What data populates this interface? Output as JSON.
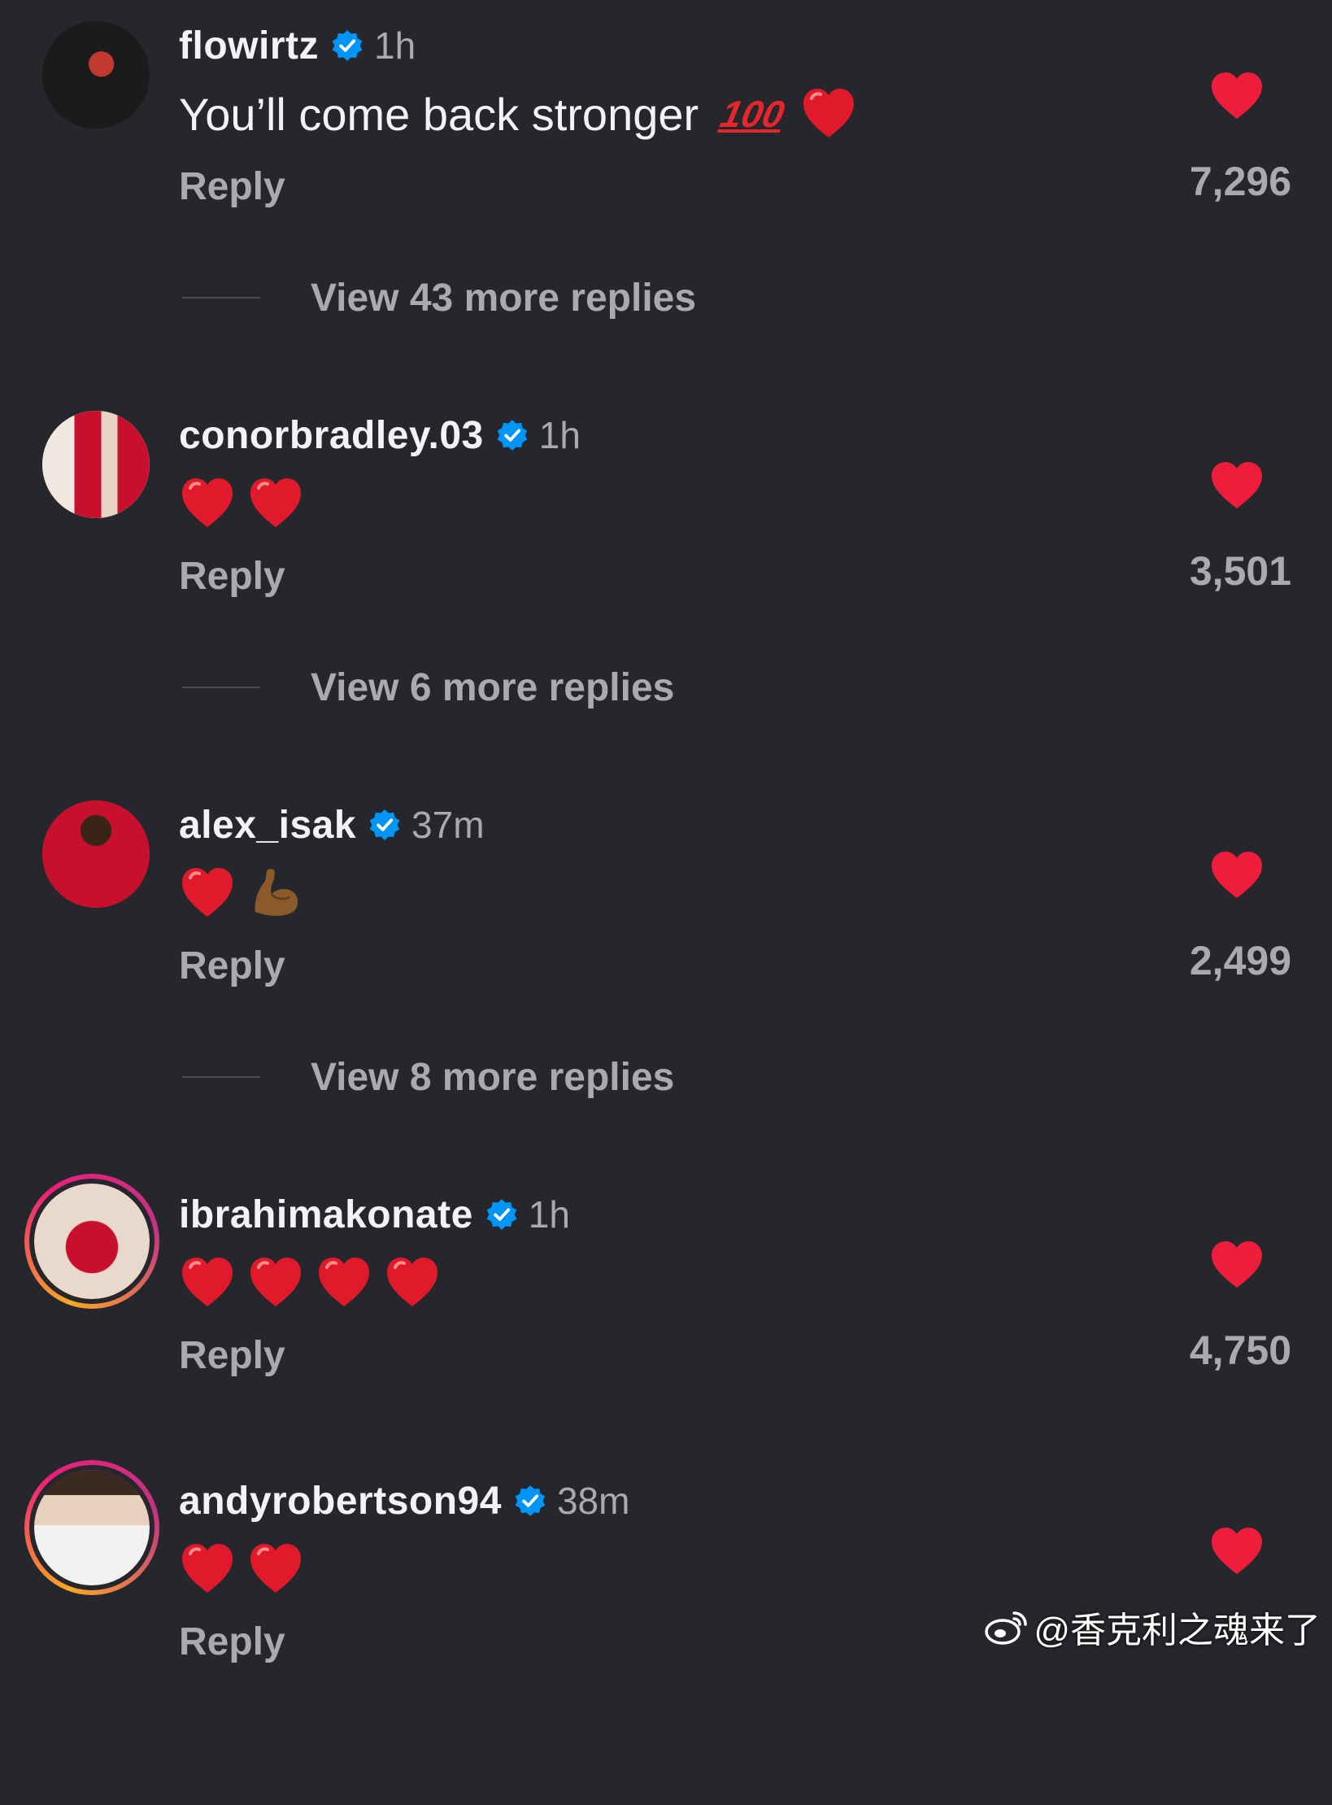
{
  "colors": {
    "background": "#25272c",
    "like": "#ed1d3b",
    "verified": "#0095f6",
    "secondary_text": "#a8aab0"
  },
  "icons": [
    "verified-badge-icon",
    "heart-like-icon",
    "red-heart-emoji",
    "hundred-points-emoji",
    "flexed-biceps-emoji",
    "weibo-logo-icon"
  ],
  "comments": [
    {
      "username": "flowirtz",
      "time": "1h",
      "text": "You’ll come back stronger",
      "emojis": [
        "hundred-points-emoji",
        "red-heart-emoji"
      ],
      "reply_label": "Reply",
      "likes": "7,296",
      "view_replies": "View 43 more replies",
      "avatar_story_ring": false
    },
    {
      "username": "conorbradley.03",
      "time": "1h",
      "text": "",
      "emojis": [
        "red-heart-emoji",
        "red-heart-emoji"
      ],
      "reply_label": "Reply",
      "likes": "3,501",
      "view_replies": "View 6 more replies",
      "avatar_story_ring": false
    },
    {
      "username": "alex_isak",
      "time": "37m",
      "text": "",
      "emojis": [
        "red-heart-emoji",
        "flexed-biceps-emoji"
      ],
      "reply_label": "Reply",
      "likes": "2,499",
      "view_replies": "View 8 more replies",
      "avatar_story_ring": false
    },
    {
      "username": "ibrahimakonate",
      "time": "1h",
      "text": "",
      "emojis": [
        "red-heart-emoji",
        "red-heart-emoji",
        "red-heart-emoji",
        "red-heart-emoji"
      ],
      "reply_label": "Reply",
      "likes": "4,750",
      "view_replies": "",
      "avatar_story_ring": true
    },
    {
      "username": "andyrobertson94",
      "time": "38m",
      "text": "",
      "emojis": [
        "red-heart-emoji",
        "red-heart-emoji"
      ],
      "reply_label": "Reply",
      "likes": "",
      "view_replies": "",
      "avatar_story_ring": true
    }
  ],
  "watermark": {
    "text": "@香克利之魂来了"
  }
}
